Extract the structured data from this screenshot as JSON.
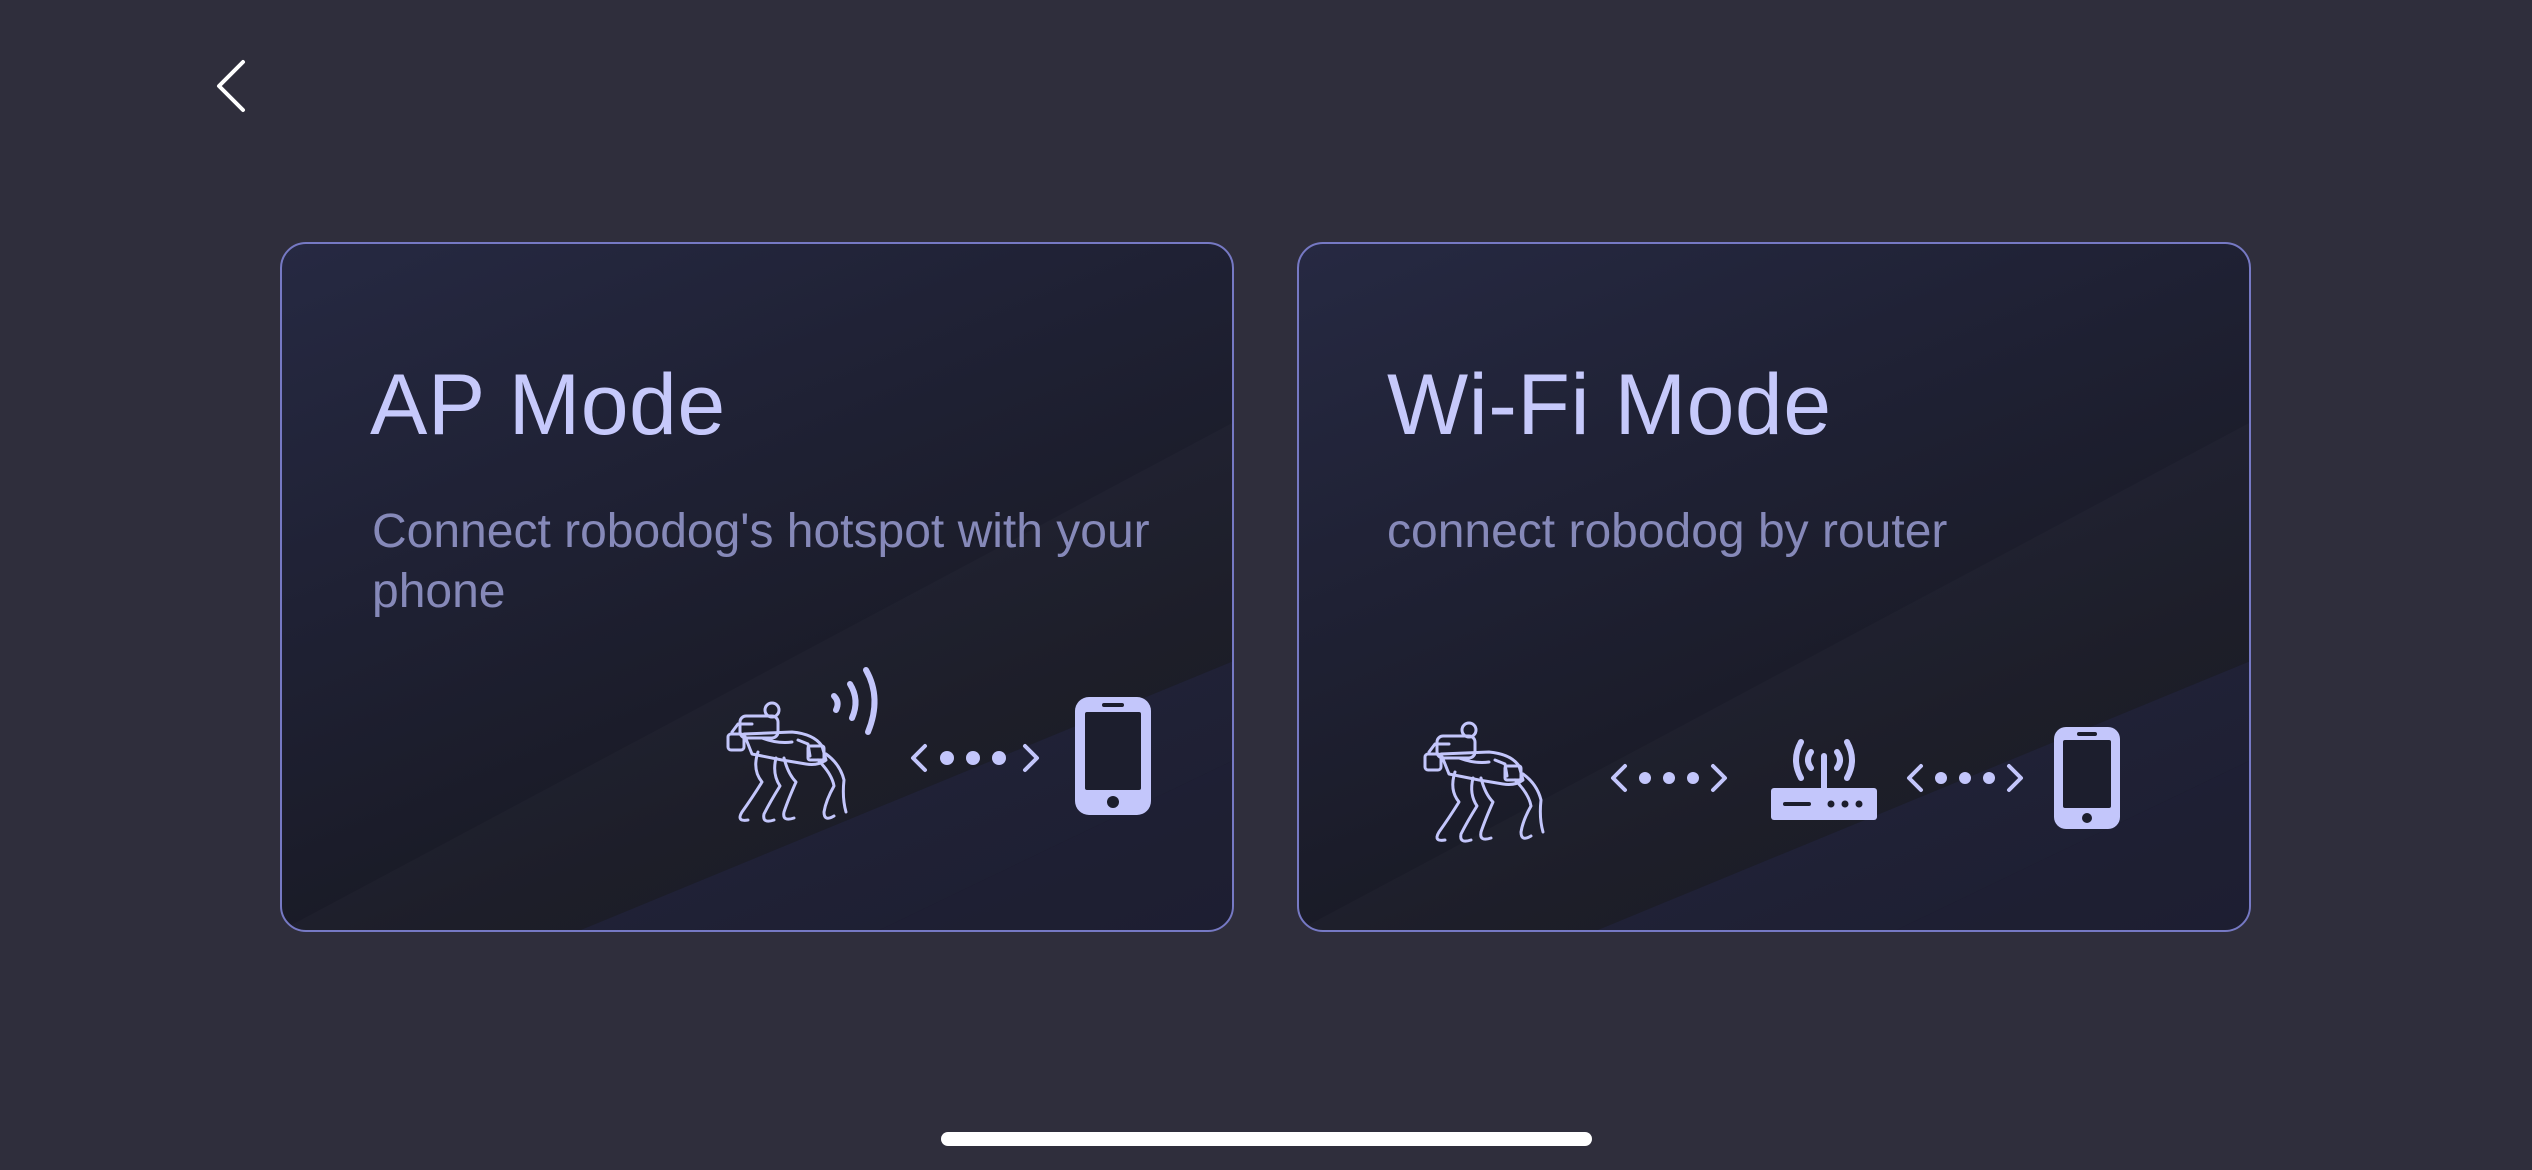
{
  "nav": {
    "back_icon": "chevron-left-icon"
  },
  "cards": [
    {
      "title": "AP Mode",
      "description": "Connect robodog's hotspot with your phone",
      "icons": [
        "robot-dog-icon",
        "signal-waves-icon",
        "connection-dots-icon",
        "smartphone-icon"
      ]
    },
    {
      "title": "Wi-Fi Mode",
      "description": "connect robodog by router",
      "icons": [
        "robot-dog-icon",
        "connection-dots-icon",
        "router-icon",
        "connection-dots-icon",
        "smartphone-icon"
      ]
    }
  ],
  "colors": {
    "background": "#2f2e3c",
    "card_border": "#7679c4",
    "title": "#c6c9fb",
    "description": "#8689b9",
    "icon": "#c3c6fb"
  }
}
